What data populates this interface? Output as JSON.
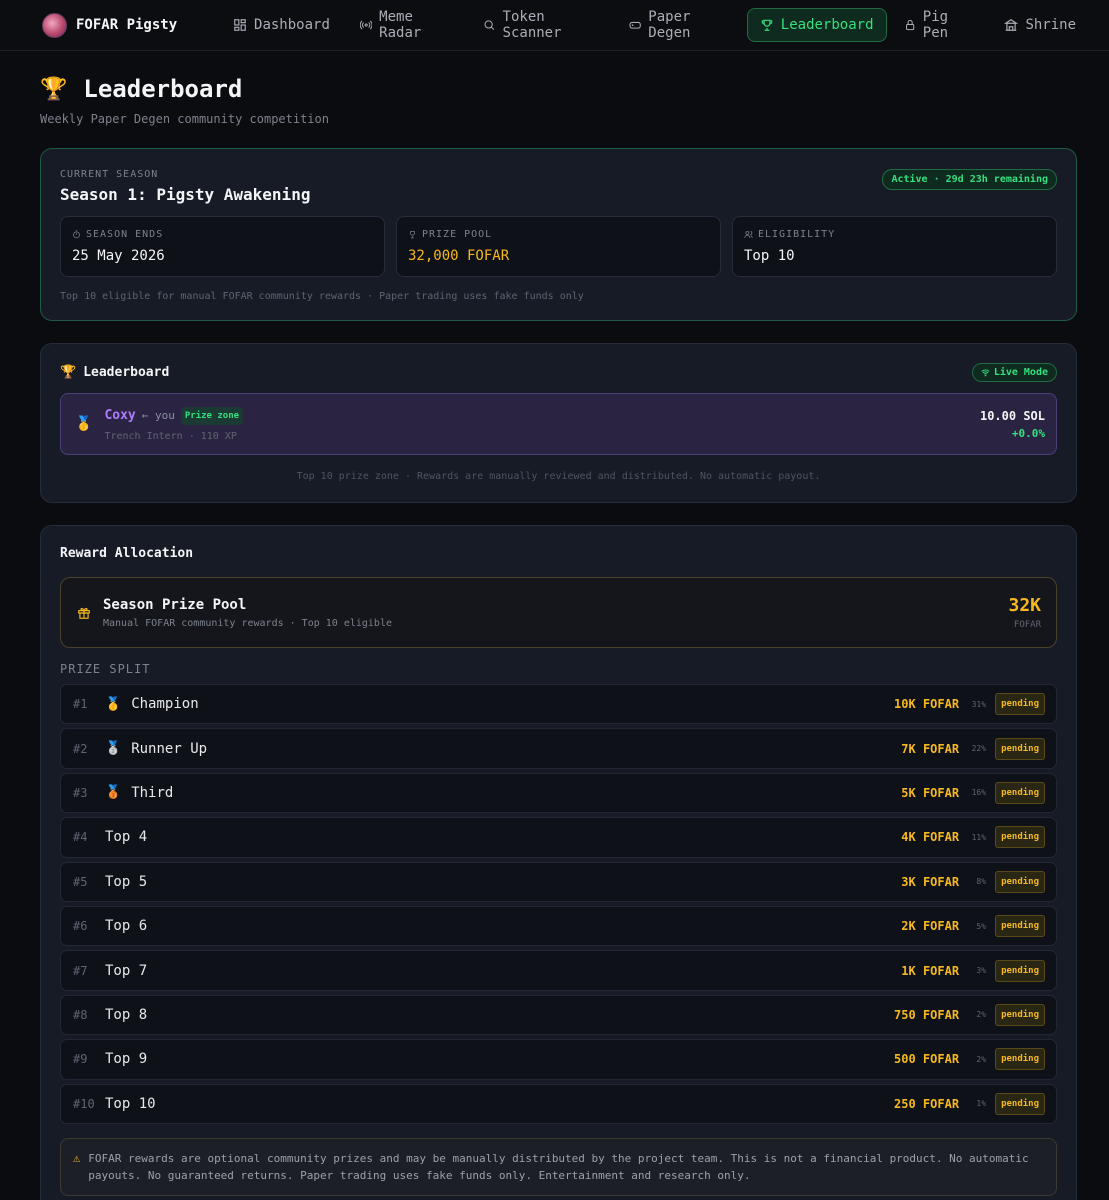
{
  "app": {
    "name": "FOFAR Pigsty"
  },
  "nav": {
    "items": [
      {
        "label": "Dashboard",
        "icon": "dashboard-icon"
      },
      {
        "label": "Meme Radar",
        "icon": "radar-icon"
      },
      {
        "label": "Token Scanner",
        "icon": "search-icon"
      },
      {
        "label": "Paper Degen",
        "icon": "gamepad-icon"
      },
      {
        "label": "Leaderboard",
        "icon": "trophy-icon",
        "active": true
      },
      {
        "label": "Pig Pen",
        "icon": "lock-icon"
      },
      {
        "label": "Shrine",
        "icon": "shrine-icon"
      }
    ]
  },
  "page": {
    "title": "Leaderboard",
    "subtitle": "Weekly Paper Degen community competition"
  },
  "season": {
    "caption": "CURRENT SEASON",
    "name": "Season 1: Pigsty Awakening",
    "badge": "Active · 29d 23h remaining",
    "stats": {
      "ends_label": "SEASON ENDS",
      "ends_value": "25 May 2026",
      "pool_label": "PRIZE POOL",
      "pool_value": "32,000 FOFAR",
      "elig_label": "ELIGIBILITY",
      "elig_value": "Top 10"
    },
    "note": "Top 10 eligible for manual FOFAR community rewards · Paper trading uses fake funds only"
  },
  "leaderboard": {
    "title": "Leaderboard",
    "mode_badge": "Live Mode",
    "me": {
      "name": "Coxy",
      "you": "← you",
      "zone": "Prize zone",
      "sub": "Trench Intern · 110 XP",
      "balance": "10.00 SOL",
      "change": "+0.0%"
    },
    "note": "Top 10 prize zone · Rewards are manually reviewed and distributed. No automatic payout."
  },
  "rewards": {
    "title": "Reward Allocation",
    "pool_title": "Season Prize Pool",
    "pool_sub": "Manual FOFAR community rewards · Top 10 eligible",
    "pool_amount": "32K",
    "pool_unit": "FOFAR",
    "split_label": "PRIZE SPLIT",
    "rows": [
      {
        "rank": "#1",
        "medal": "🥇",
        "name": "Champion",
        "amount": "10K FOFAR",
        "pct": "31%",
        "status": "pending"
      },
      {
        "rank": "#2",
        "medal": "🥈",
        "name": "Runner Up",
        "amount": "7K FOFAR",
        "pct": "22%",
        "status": "pending"
      },
      {
        "rank": "#3",
        "medal": "🥉",
        "name": "Third",
        "amount": "5K FOFAR",
        "pct": "16%",
        "status": "pending"
      },
      {
        "rank": "#4",
        "medal": "",
        "name": "Top 4",
        "amount": "4K FOFAR",
        "pct": "11%",
        "status": "pending"
      },
      {
        "rank": "#5",
        "medal": "",
        "name": "Top 5",
        "amount": "3K FOFAR",
        "pct": "8%",
        "status": "pending"
      },
      {
        "rank": "#6",
        "medal": "",
        "name": "Top 6",
        "amount": "2K FOFAR",
        "pct": "5%",
        "status": "pending"
      },
      {
        "rank": "#7",
        "medal": "",
        "name": "Top 7",
        "amount": "1K FOFAR",
        "pct": "3%",
        "status": "pending"
      },
      {
        "rank": "#8",
        "medal": "",
        "name": "Top 8",
        "amount": "750 FOFAR",
        "pct": "2%",
        "status": "pending"
      },
      {
        "rank": "#9",
        "medal": "",
        "name": "Top 9",
        "amount": "500 FOFAR",
        "pct": "2%",
        "status": "pending"
      },
      {
        "rank": "#10",
        "medal": "",
        "name": "Top 10",
        "amount": "250 FOFAR",
        "pct": "1%",
        "status": "pending"
      }
    ],
    "disclaimer": "FOFAR rewards are optional community prizes and may be manually distributed by the project team. This is not a financial product. No automatic payouts. No guaranteed returns. Paper trading uses fake funds only. Entertainment and research only."
  },
  "colors": {
    "accent_green": "#34e07f",
    "gold": "#f5b820",
    "purple": "#b07bff",
    "background": "#0a0c10"
  }
}
